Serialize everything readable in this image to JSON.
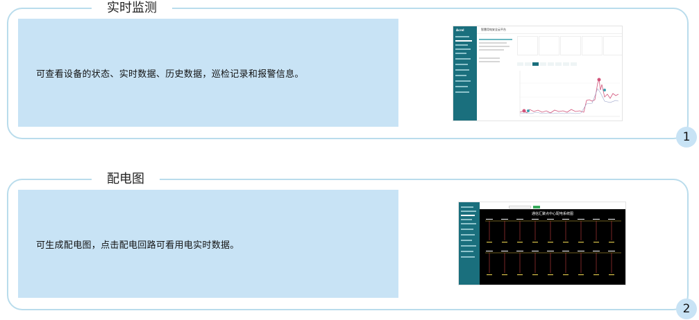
{
  "sections": [
    {
      "title": "实时监测",
      "description": "可查看设备的状态、实时数据、历史数据，巡检记录和报警信息。",
      "number": "1"
    },
    {
      "title": "配电图",
      "description": "可生成配电图，点击配电回路可看用电实时数据。",
      "number": "2"
    }
  ],
  "thumbnail1": {
    "logo": "Acrel",
    "header_title": "智慧用电安全云平台"
  },
  "thumbnail2": {
    "diagram_title": "通信汇聚点中心配电系统图"
  },
  "colors": {
    "panel_bg": "#c8e3f5",
    "border": "#b9dcec",
    "sidebar": "#1a6f7d",
    "chart_line": "#d2547a",
    "diagram_bg": "#000000"
  }
}
